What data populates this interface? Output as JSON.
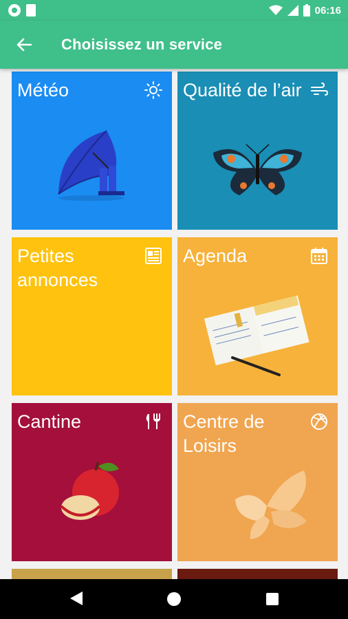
{
  "status": {
    "time": "06:16"
  },
  "header": {
    "title": "Choisissez un service"
  },
  "tiles": [
    {
      "label": "Météo",
      "color": "#1a8cf2",
      "icon": "sun-icon"
    },
    {
      "label": "Qualité de l’air",
      "color": "#1a8eb5",
      "icon": "wind-icon"
    },
    {
      "label": "Petites annonces",
      "color": "#ffc20e",
      "icon": "newspaper-icon"
    },
    {
      "label": "Agenda",
      "color": "#f6b23a",
      "icon": "calendar-icon"
    },
    {
      "label": "Cantine",
      "color": "#a40f3b",
      "icon": "cutlery-icon"
    },
    {
      "label": "Centre de Loisirs",
      "color": "#f0a550",
      "icon": "basketball-icon"
    }
  ],
  "colors": {
    "primary": "#3fbf8a"
  }
}
